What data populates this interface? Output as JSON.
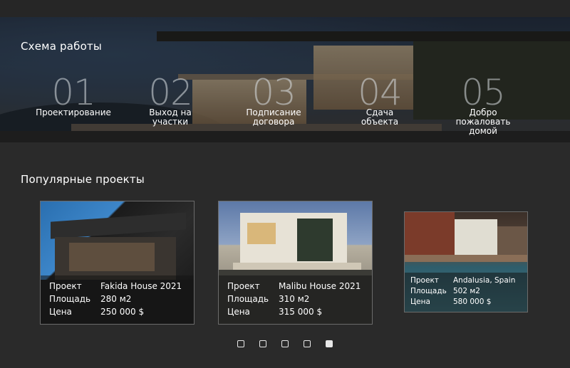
{
  "steps_section": {
    "title": "Схема работы",
    "steps": [
      {
        "num": "01",
        "label": "Проектирование"
      },
      {
        "num": "02",
        "label": "Выход на\nучастки"
      },
      {
        "num": "03",
        "label": "Подписание\nдоговора"
      },
      {
        "num": "04",
        "label": "Сдача\nобъекта"
      },
      {
        "num": "05",
        "label": "Добро\nпожаловать\nдомой"
      }
    ]
  },
  "projects_section": {
    "title": "Популярные проекты",
    "labels": {
      "project": "Проект",
      "area": "Площадь",
      "price": "Цена"
    },
    "cards": [
      {
        "name": "Fakida House 2021",
        "area": "280 м2",
        "price": "250 000 $"
      },
      {
        "name": "Malibu House 2021",
        "area": "310 м2",
        "price": "315 000 $"
      },
      {
        "name": "Andalusia, Spain",
        "area": "502 м2",
        "price": "580 000 $"
      }
    ]
  },
  "slider": {
    "count": 5,
    "active_index": 4
  },
  "colors": {
    "background": "#2a2a2a",
    "text": "#ffffff",
    "step_number": "#c8cdd2"
  }
}
